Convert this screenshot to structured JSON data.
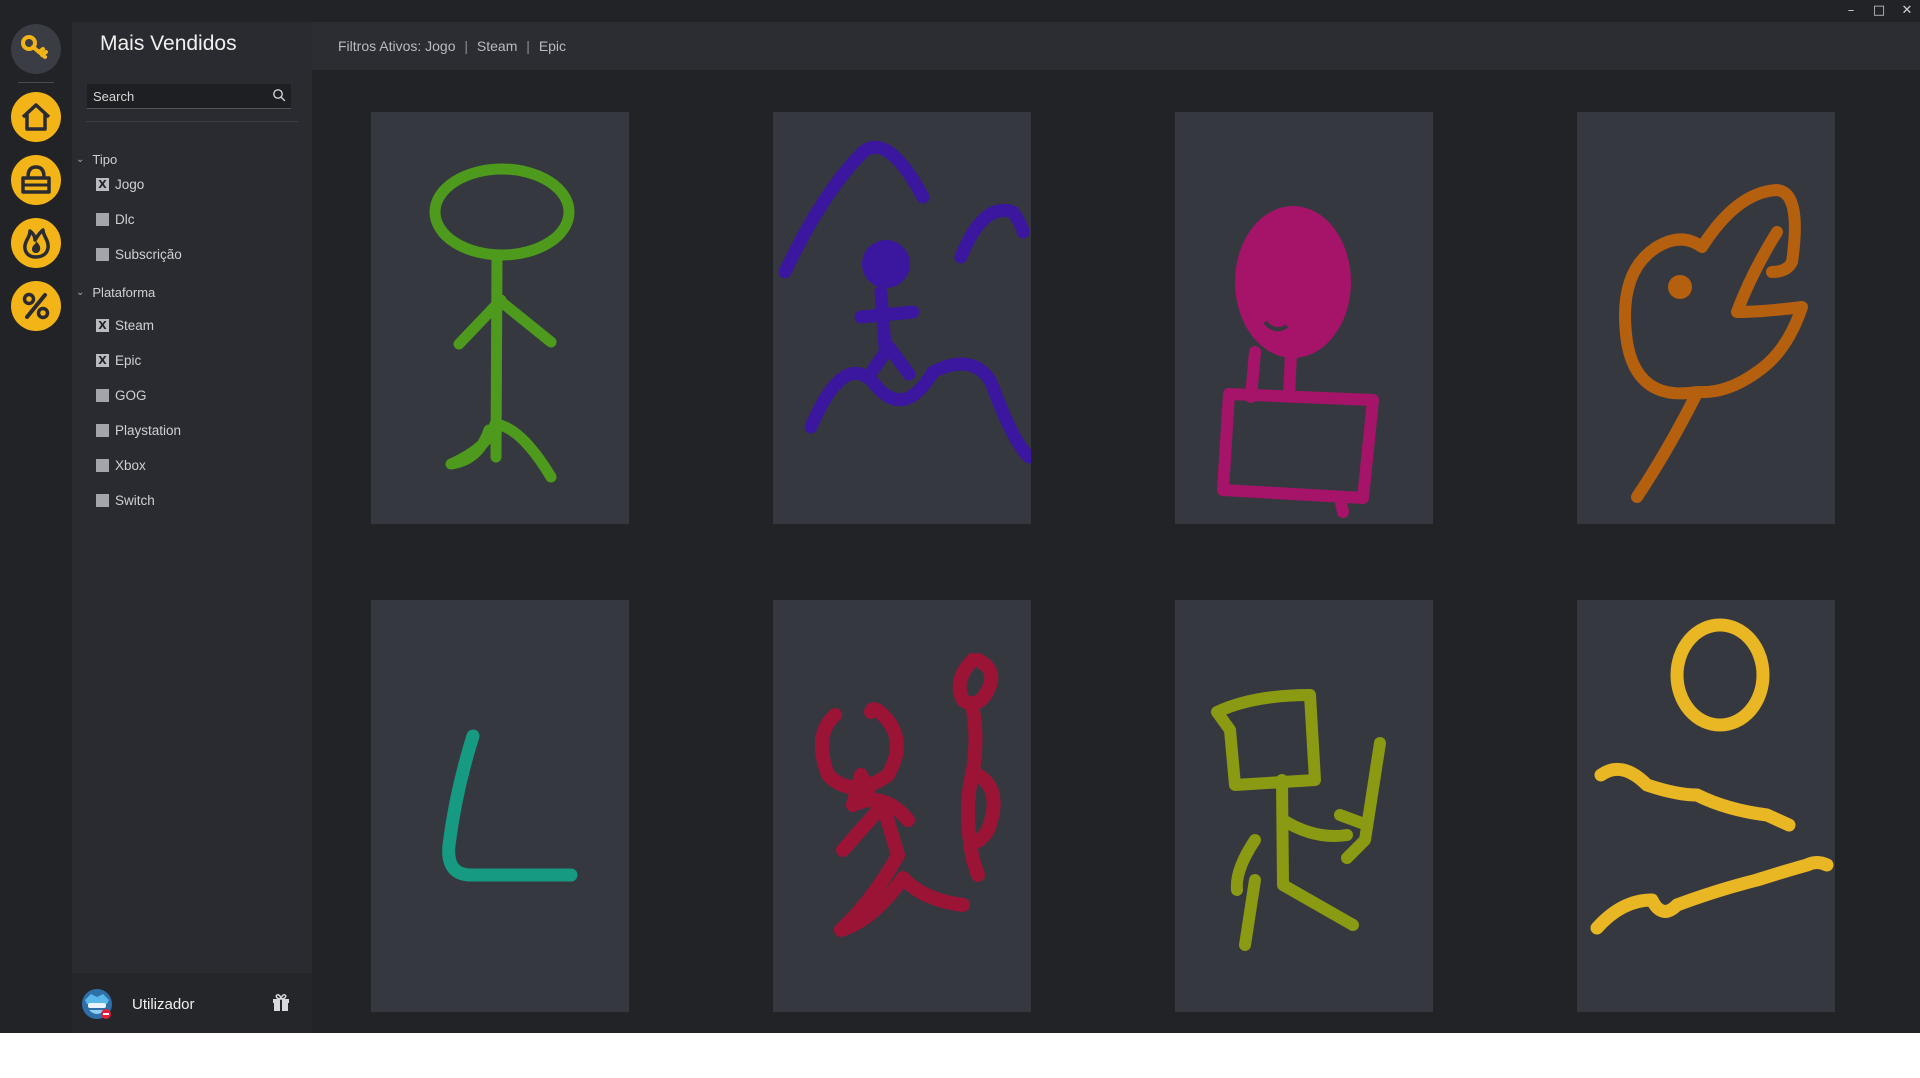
{
  "window": {
    "controls": [
      "minimize-icon",
      "maximize-icon",
      "close-icon"
    ],
    "control_glyphs": [
      "–",
      "□",
      "✕"
    ]
  },
  "rail": {
    "items": [
      {
        "name": "key-logo-icon"
      },
      {
        "name": "home-icon"
      },
      {
        "name": "shopping-bag-icon"
      },
      {
        "name": "fire-icon"
      },
      {
        "name": "percent-icon"
      }
    ],
    "accent": "#f2b416"
  },
  "sidebar": {
    "title": "Mais Vendidos",
    "search": {
      "placeholder": "Search",
      "value": ""
    },
    "sections": [
      {
        "label": "Tipo",
        "options": [
          {
            "label": "Jogo",
            "checked": true
          },
          {
            "label": "Dlc",
            "checked": false
          },
          {
            "label": "Subscrição",
            "checked": false
          }
        ]
      },
      {
        "label": "Plataforma",
        "options": [
          {
            "label": "Steam",
            "checked": true
          },
          {
            "label": "Epic",
            "checked": true
          },
          {
            "label": "GOG",
            "checked": false
          },
          {
            "label": "Playstation",
            "checked": false
          },
          {
            "label": "Xbox",
            "checked": false
          },
          {
            "label": "Switch",
            "checked": false
          }
        ]
      }
    ],
    "user": {
      "name": "Utilizador"
    }
  },
  "topbar": {
    "prefix": "Filtros Ativos:",
    "filters": [
      "Jogo",
      "Steam",
      "Epic"
    ],
    "separator": "|"
  },
  "products": [
    {
      "name": "product-card-green-stickman",
      "color": "#4d9a1d"
    },
    {
      "name": "product-card-purple-mountains",
      "color": "#3a179e"
    },
    {
      "name": "product-card-magenta-figure",
      "color": "#a51468"
    },
    {
      "name": "product-card-orange-tree",
      "color": "#b5600f"
    },
    {
      "name": "product-card-teal-l-shape",
      "color": "#169a82"
    },
    {
      "name": "product-card-red-figures",
      "color": "#9b1436"
    },
    {
      "name": "product-card-olive-robot",
      "color": "#8a9a12"
    },
    {
      "name": "product-card-yellow-sun-waves",
      "color": "#e9b624"
    }
  ]
}
